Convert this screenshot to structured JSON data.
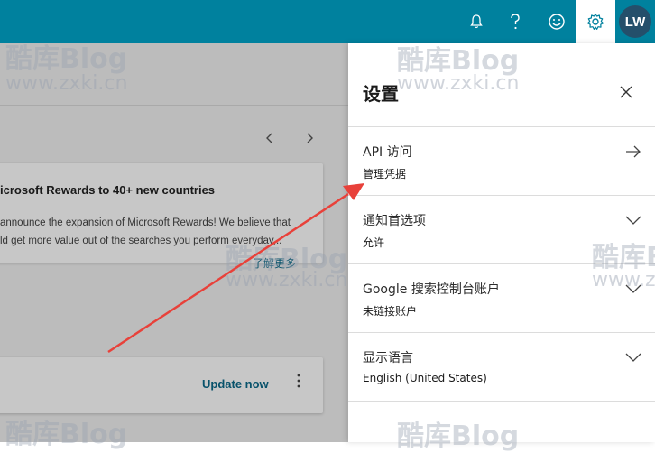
{
  "header": {
    "icons": [
      "bell-icon",
      "help-icon",
      "smiley-icon",
      "gear-icon"
    ],
    "avatar_initials": "LW",
    "bar_color": "#00819e"
  },
  "background": {
    "news_card": {
      "title": "icrosoft Rewards to 40+ new countries",
      "line1": "announce the expansion of Microsoft Rewards! We believe that",
      "line2": "ld get more value out of the searches you perform everyday,..",
      "link": "了解更多"
    },
    "update_card": {
      "button": "Update now"
    }
  },
  "settings": {
    "title": "设置",
    "items": [
      {
        "label": "API 访问",
        "value": "管理凭据",
        "control": "arrow-right-icon"
      },
      {
        "label": "通知首选项",
        "value": "允许",
        "control": "chevron-down-icon"
      },
      {
        "label": "Google 搜索控制台账户",
        "value": "未链接账户",
        "control": "chevron-down-icon"
      },
      {
        "label": "显示语言",
        "value": "English (United States)",
        "control": "chevron-down-icon"
      }
    ]
  },
  "watermark": {
    "logo": "酷库Blog",
    "url": "www.zxki.cn"
  },
  "colors": {
    "accent": "#00819e",
    "link": "#0b6a8a",
    "annotation_arrow": "#e8413a"
  }
}
